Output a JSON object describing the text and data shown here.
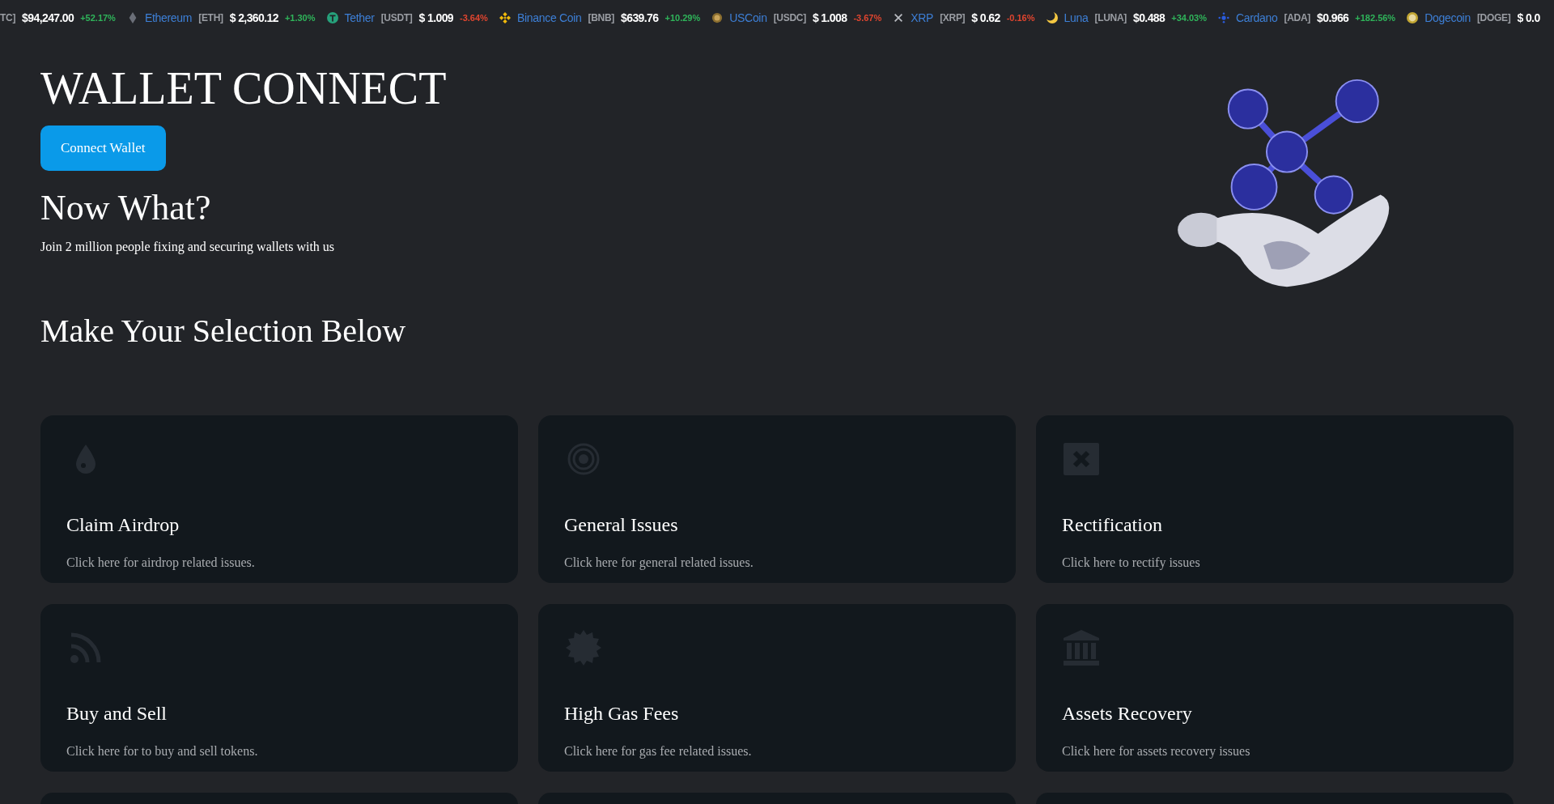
{
  "ticker": [
    {
      "symbol": "TC]",
      "price": "$94,247.00",
      "change": "+52.17%",
      "color": "#2fb45a"
    },
    {
      "name": "Ethereum",
      "symbol": "[ETH]",
      "price": "$ 2,360.12",
      "change": "+1.30%",
      "color": "#2fb45a"
    },
    {
      "name": "Tether",
      "symbol": "[USDT]",
      "price": "$ 1.009",
      "change": "-3.64%",
      "color": "#e0452f"
    },
    {
      "name": "Binance Coin",
      "symbol": "[BNB]",
      "price": "$639.76",
      "change": "+10.29%",
      "color": "#2fb45a"
    },
    {
      "name": "USCoin",
      "symbol": "[USDC]",
      "price": "$ 1.008",
      "change": "-3.67%",
      "color": "#e0452f"
    },
    {
      "name": "XRP",
      "symbol": "[XRP]",
      "price": "$ 0.62",
      "change": "-0.16%",
      "color": "#e0452f"
    },
    {
      "name": "Luna",
      "symbol": "[LUNA]",
      "price": "$0.488",
      "change": "+34.03%",
      "color": "#2fb45a"
    },
    {
      "name": "Cardano",
      "symbol": "[ADA]",
      "price": "$0.966",
      "change": "+182.56%",
      "color": "#2fb45a"
    },
    {
      "name": "Dogecoin",
      "symbol": "[DOGE]",
      "price": "$ 0.0"
    }
  ],
  "title": "WALLET CONNECT",
  "connect_button": "Connect Wallet",
  "subheading": "Now What?",
  "tagline": "Join 2 million people fixing and securing wallets with us",
  "section_title": "Make Your Selection Below",
  "cards": [
    {
      "kind": "option",
      "title": "Claim Airdrop",
      "description": "Click here for airdrop related issues."
    },
    {
      "kind": "option",
      "title": "General Issues",
      "description": "Click here for general related issues."
    },
    {
      "kind": "option",
      "title": "Rectification",
      "description": "Click here to rectify issues"
    },
    {
      "kind": "option",
      "title": "Buy and Sell",
      "description": "Click here for to buy and sell tokens."
    },
    {
      "kind": "option",
      "title": "High Gas Fees",
      "description": "Click here for gas fee related issues."
    },
    {
      "kind": "option",
      "title": "Assets Recovery",
      "description": "Click here for assets recovery issues"
    },
    {
      "kind": "cut"
    },
    {
      "kind": "cut"
    },
    {
      "kind": "cut"
    }
  ]
}
